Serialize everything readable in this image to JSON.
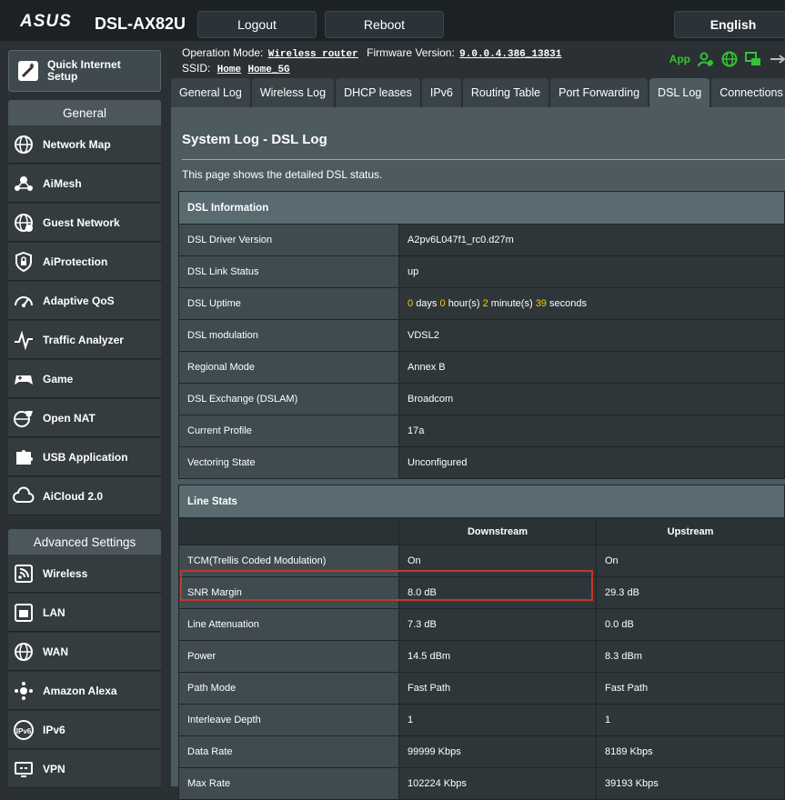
{
  "header": {
    "brand": "ASUS",
    "model": "DSL-AX82U",
    "logout_label": "Logout",
    "reboot_label": "Reboot",
    "language": "English",
    "operation_mode_label": "Operation Mode:",
    "operation_mode_value": "Wireless router",
    "firmware_label": "Firmware Version:",
    "firmware_value": "9.0.0.4.386_13831",
    "ssid_label": "SSID:",
    "ssid_values": [
      "Home",
      "Home_5G"
    ],
    "app_label": "App"
  },
  "tabs": [
    "General Log",
    "Wireless Log",
    "DHCP leases",
    "IPv6",
    "Routing Table",
    "Port Forwarding",
    "DSL Log",
    "Connections"
  ],
  "sidebar": {
    "qis_label_line1": "Quick Internet",
    "qis_label_line2": "Setup",
    "general_head": "General",
    "general_items": [
      "Network Map",
      "AiMesh",
      "Guest Network",
      "AiProtection",
      "Adaptive QoS",
      "Traffic Analyzer",
      "Game",
      "Open NAT",
      "USB Application",
      "AiCloud 2.0"
    ],
    "advanced_head": "Advanced Settings",
    "advanced_items": [
      "Wireless",
      "LAN",
      "WAN",
      "Amazon Alexa",
      "IPv6",
      "VPN"
    ]
  },
  "page": {
    "title": "System Log - DSL Log",
    "description": "This page shows the detailed DSL status."
  },
  "dsl_info": {
    "heading": "DSL Information",
    "rows": [
      {
        "label": "DSL Driver Version",
        "value": "A2pv6L047f1_rc0.d27m"
      },
      {
        "label": "DSL Link Status",
        "value": "up"
      },
      {
        "label": "DSL Uptime",
        "value": ""
      },
      {
        "label": "DSL modulation",
        "value": "VDSL2"
      },
      {
        "label": "Regional Mode",
        "value": "Annex B"
      },
      {
        "label": "DSL Exchange (DSLAM)",
        "value": "Broadcom"
      },
      {
        "label": "Current Profile",
        "value": "17a"
      },
      {
        "label": "Vectoring State",
        "value": "Unconfigured"
      }
    ],
    "uptime": {
      "days": "0",
      "days_label": "days",
      "hours": "0",
      "hours_label": "hour(s)",
      "minutes": "2",
      "minutes_label": "minute(s)",
      "seconds": "39",
      "seconds_label": "seconds"
    }
  },
  "line_stats": {
    "heading": "Line Stats",
    "col_downstream": "Downstream",
    "col_upstream": "Upstream",
    "rows": [
      {
        "label": "TCM(Trellis Coded Modulation)",
        "down": "On",
        "up": "On"
      },
      {
        "label": "SNR Margin",
        "down": "8.0 dB",
        "up": "29.3 dB"
      },
      {
        "label": "Line Attenuation",
        "down": "7.3 dB",
        "up": "0.0 dB"
      },
      {
        "label": "Power",
        "down": "14.5 dBm",
        "up": "8.3 dBm"
      },
      {
        "label": "Path Mode",
        "down": "Fast Path",
        "up": "Fast Path"
      },
      {
        "label": "Interleave Depth",
        "down": "1",
        "up": "1"
      },
      {
        "label": "Data Rate",
        "down": "99999 Kbps",
        "up": "8189 Kbps"
      },
      {
        "label": "Max Rate",
        "down": "102224 Kbps",
        "up": "39193 Kbps"
      }
    ]
  },
  "colors": {
    "highlight": "#c0392b",
    "accent_yellow": "#ffcc00",
    "app_green": "#35c235"
  }
}
